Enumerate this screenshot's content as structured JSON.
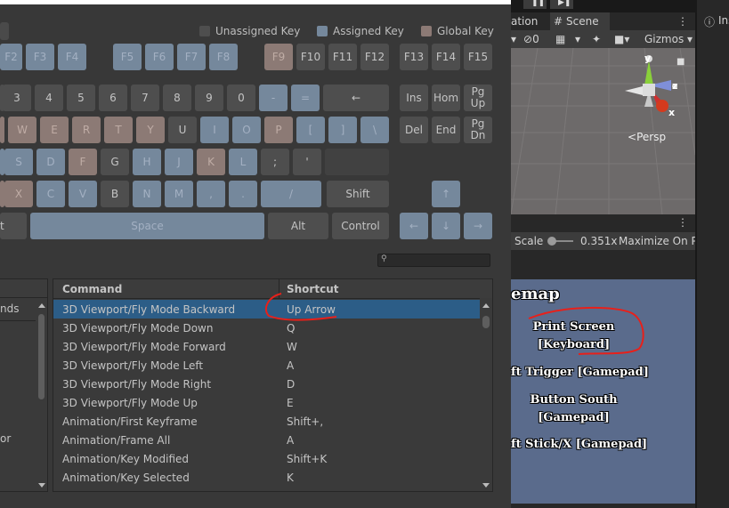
{
  "legend": {
    "unassigned": "Unassigned Key",
    "assigned": "Assigned Key",
    "global": "Global Key",
    "colors": {
      "unassigned": "#4e4e4e",
      "assigned": "#75889c",
      "global": "#8c7a75"
    }
  },
  "keys": {
    "f2": "F2",
    "f3": "F3",
    "f4": "F4",
    "f5": "F5",
    "f6": "F6",
    "f7": "F7",
    "f8": "F8",
    "f9": "F9",
    "f10": "F10",
    "f11": "F11",
    "f12": "F12",
    "f13": "F13",
    "f14": "F14",
    "f15": "F15",
    "k3": "3",
    "k4": "4",
    "k5": "5",
    "k6": "6",
    "k7": "7",
    "k8": "8",
    "k9": "9",
    "k0": "0",
    "minus": "-",
    "equals": "=",
    "backspace": "←",
    "ins": "Ins",
    "home": "Hom",
    "pgup": "Pg\nUp",
    "w": "W",
    "e": "E",
    "r": "R",
    "t": "T",
    "y": "Y",
    "u": "U",
    "i": "I",
    "o": "O",
    "p": "P",
    "lbracket": "[",
    "rbracket": "]",
    "backslash": "\\",
    "del": "Del",
    "end": "End",
    "pgdn": "Pg\nDn",
    "s": "S",
    "d": "D",
    "f": "F",
    "g": "G",
    "h": "H",
    "j": "J",
    "k": "K",
    "l": "L",
    "semicolon": ";",
    "quote": "'",
    "x": "X",
    "c": "C",
    "v": "V",
    "b": "B",
    "n": "N",
    "m": "M",
    "comma": ",",
    "period": ".",
    "slash": "/",
    "shift": "Shift",
    "up": "↑",
    "alt_left_partial": "t",
    "space": "Space",
    "alt": "Alt",
    "control": "Control",
    "left": "←",
    "down": "↓",
    "right": "→"
  },
  "categories": {
    "partial": "nds",
    "partial2": "or"
  },
  "table": {
    "col_command": "Command",
    "col_shortcut": "Shortcut",
    "rows": [
      {
        "command": "3D Viewport/Fly Mode Backward",
        "shortcut": "Up Arrow"
      },
      {
        "command": "3D Viewport/Fly Mode Down",
        "shortcut": "Q"
      },
      {
        "command": "3D Viewport/Fly Mode Forward",
        "shortcut": "W"
      },
      {
        "command": "3D Viewport/Fly Mode Left",
        "shortcut": "A"
      },
      {
        "command": "3D Viewport/Fly Mode Right",
        "shortcut": "D"
      },
      {
        "command": "3D Viewport/Fly Mode Up",
        "shortcut": "E"
      },
      {
        "command": "Animation/First Keyframe",
        "shortcut": "Shift+,"
      },
      {
        "command": "Animation/Frame All",
        "shortcut": "A"
      },
      {
        "command": "Animation/Key Modified",
        "shortcut": "Shift+K"
      },
      {
        "command": "Animation/Key Selected",
        "shortcut": "K"
      }
    ]
  },
  "scene": {
    "tab_animation_partial": "ation",
    "tab_scene": "Scene",
    "tab_inspector_partial": "Ins",
    "gizmos": "Gizmos",
    "hidden_count": "0",
    "persp": "Persp",
    "axis_y": "y",
    "axis_z": "z",
    "axis_x": "x",
    "scale_label": "Scale",
    "scale_value": "0.351x",
    "maximize": "Maximize On P"
  },
  "game": {
    "title_partial": "emap",
    "line1": "Print Screen",
    "line2": "[Keyboard]",
    "line3": "ft Trigger [Gamepad]",
    "line4": "Button South",
    "line5": "[Gamepad]",
    "line6": "ft Stick/X [Gamepad]"
  }
}
